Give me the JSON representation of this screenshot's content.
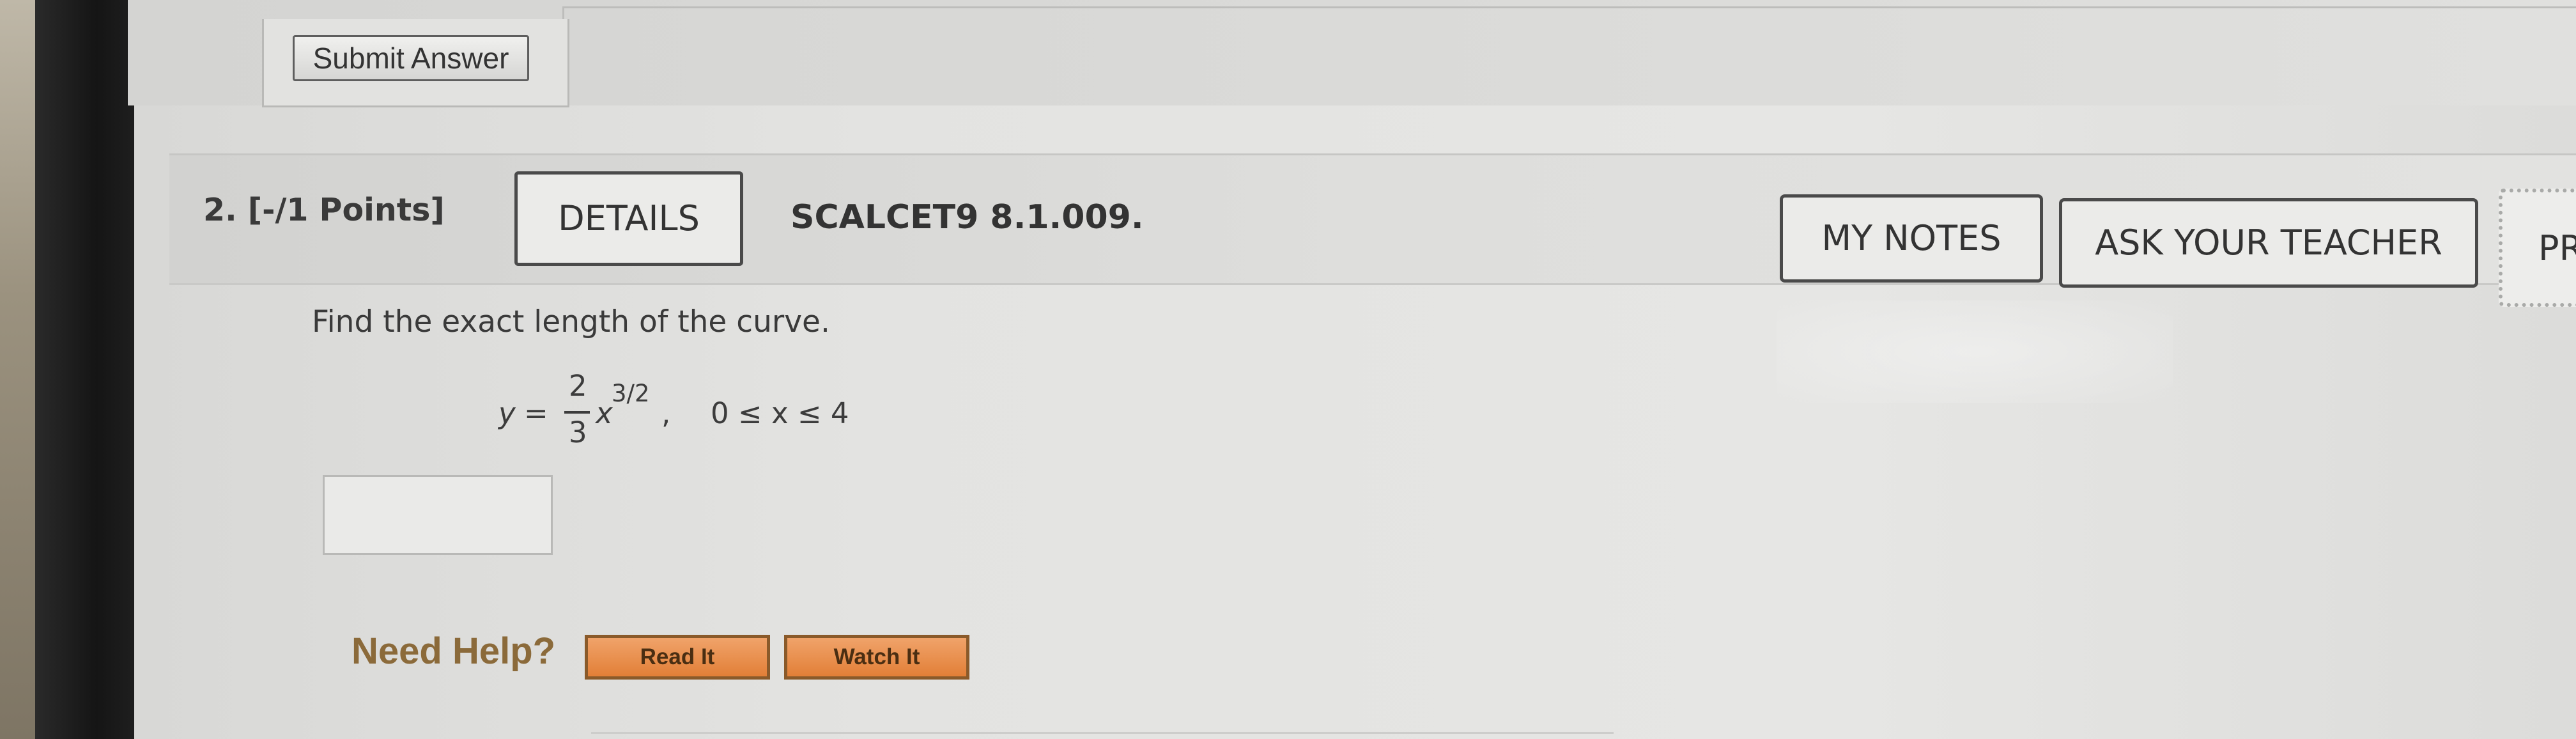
{
  "previous": {
    "submit_label": "Submit Answer"
  },
  "question": {
    "number_points": "2.  [-/1 Points]",
    "details_label": "DETAILS",
    "code": "SCALCET9 8.1.009.",
    "my_notes_label": "MY NOTES",
    "ask_teacher_label": "ASK YOUR TEACHER",
    "practice_label": "PR"
  },
  "problem": {
    "instruction": "Find the exact length of the curve.",
    "equation": {
      "lhs": "y",
      "equals": "=",
      "numerator": "2",
      "denominator": "3",
      "variable": "x",
      "exponent": "3/2",
      "separator": ",",
      "domain": "0 ≤ x ≤ 4"
    },
    "answer_value": ""
  },
  "help": {
    "label": "Need Help?",
    "read_label": "Read It",
    "watch_label": "Watch It"
  },
  "colors": {
    "help_button": "#e88c45",
    "need_help_text": "#8b6a3a",
    "button_border": "#4a4a4a"
  }
}
